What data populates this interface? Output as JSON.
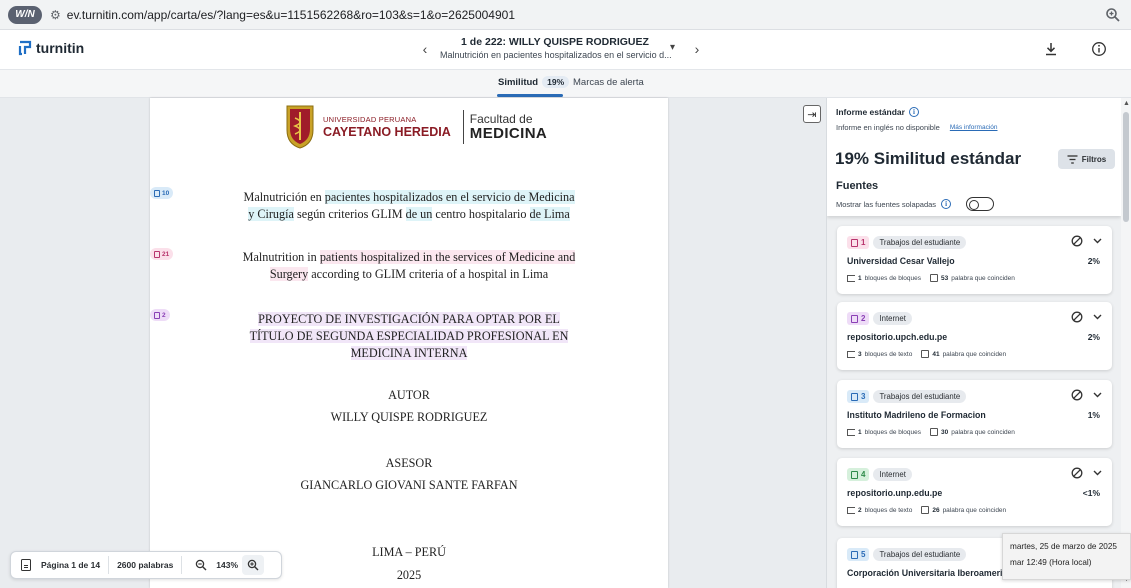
{
  "browser": {
    "ext_label": "W/N",
    "url": "ev.turnitin.com/app/carta/es/?lang=es&u=1151562268&ro=103&s=1&o=2625004901"
  },
  "topbar": {
    "brand": "turnitin",
    "doc_counter": "1 de 222: WILLY QUISPE RODRIGUEZ",
    "doc_subtitle": "Malnutrición en pacientes hospitalizados en el servicio d..."
  },
  "tabs": {
    "similarity_label": "Similitud",
    "similarity_pct": "19%",
    "flags_label": "Marcas de alerta"
  },
  "document": {
    "logo": {
      "uni_line1": "UNIVERSIDAD PERUANA",
      "uni_line2": "CAYETANO HEREDIA",
      "fac_line1": "Facultad de",
      "fac_line2": "MEDICINA"
    },
    "badges": [
      {
        "count": "10",
        "color": "#2a6bb6"
      },
      {
        "count": "21",
        "color": "#b8346d"
      },
      {
        "count": "2",
        "color": "#8a3fb5"
      }
    ],
    "title_es": {
      "p1": "Malnutrición en ",
      "h1": "pacientes hospitalizados en el servicio de Medicina",
      "h2": "y Cirugía",
      "p2": " según criterios GLIM ",
      "h3": "de un",
      "p3": " centro hospitalario ",
      "h4": "de Lima"
    },
    "title_en": {
      "p1": "Malnutrition in ",
      "h1": "patients hospitalized in the services of Medicine and",
      "h2": "Surgery",
      "p2": " according to GLIM criteria of a hospital in Lima"
    },
    "project": {
      "line1": "PROYECTO DE INVESTIGACIÓN PARA OPTAR POR EL",
      "line2": "TÍTULO DE SEGUNDA ESPECIALIDAD PROFESIONAL EN",
      "line3": "MEDICINA INTERNA"
    },
    "author_heading": "AUTOR",
    "author_name": "WILLY QUISPE RODRIGUEZ",
    "advisor_heading": "ASESOR",
    "advisor_name": "GIANCARLO GIOVANI SANTE FARFAN",
    "place": "LIMA – PERÚ",
    "year": "2025"
  },
  "bottombar": {
    "page_label": "Página 1 de 14",
    "words_label": "2600 palabras",
    "zoom_label": "143%"
  },
  "panel": {
    "report_label": "Informe estándar",
    "english_note": "Informe en inglés no disponible",
    "more_info": "Más información",
    "title": "19% Similitud estándar",
    "filters_label": "Filtros",
    "sources_label": "Fuentes",
    "overlap_label": "Mostrar las fuentes solapadas",
    "cards": [
      {
        "num": "1",
        "type": "Trabajos del estudiante",
        "name": "Universidad Cesar Vallejo",
        "pct": "2%",
        "blocks": "1",
        "blocks_label": "bloques de bloques",
        "words": "53",
        "words_label": "palabra que coinciden",
        "chip_bg": "#fbe0ea",
        "chip_fg": "#b8346d"
      },
      {
        "num": "2",
        "type": "Internet",
        "name": "repositorio.upch.edu.pe",
        "pct": "2%",
        "blocks": "3",
        "blocks_label": "bloques de texto",
        "words": "41",
        "words_label": "palabra que coinciden",
        "chip_bg": "#eedcf7",
        "chip_fg": "#8a3fb5"
      },
      {
        "num": "3",
        "type": "Trabajos del estudiante",
        "name": "Instituto Madrileno de Formacion",
        "pct": "1%",
        "blocks": "1",
        "blocks_label": "bloques de bloques",
        "words": "30",
        "words_label": "palabra que coinciden",
        "chip_bg": "#d9eaf8",
        "chip_fg": "#2a6bb6"
      },
      {
        "num": "4",
        "type": "Internet",
        "name": "repositorio.unp.edu.pe",
        "pct": "<1%",
        "blocks": "2",
        "blocks_label": "bloques de texto",
        "words": "26",
        "words_label": "palabra que coinciden",
        "chip_bg": "#d6f0dc",
        "chip_fg": "#2e8b4a"
      },
      {
        "num": "5",
        "type": "Trabajos del estudiante",
        "name": "Corporación Universitaria Iberoamericana",
        "pct": "",
        "blocks": "",
        "blocks_label": "",
        "words": "",
        "words_label": "",
        "chip_bg": "#d9eaf8",
        "chip_fg": "#2a6bb6"
      }
    ]
  },
  "tooltip": {
    "date": "martes, 25 de marzo de 2025",
    "time": "mar 12:49 (Hora local)"
  }
}
